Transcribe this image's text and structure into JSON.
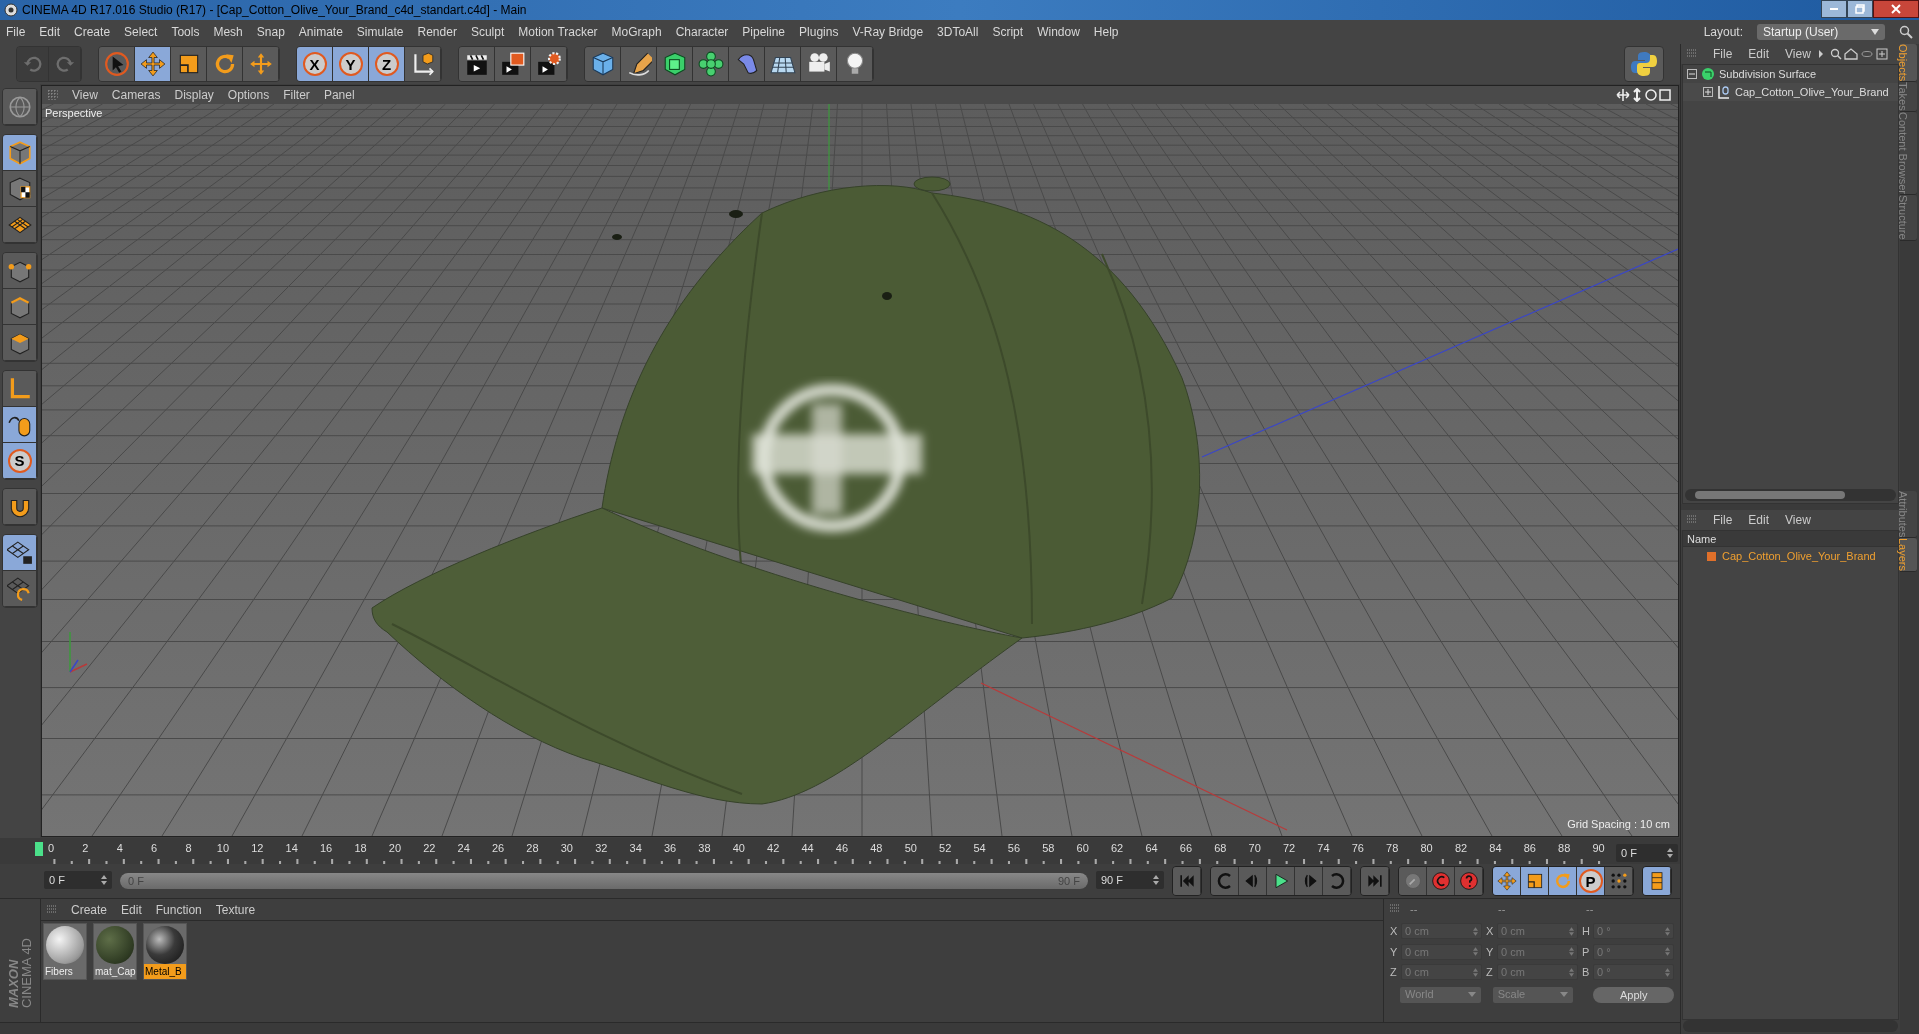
{
  "window": {
    "title": "CINEMA 4D R17.016 Studio (R17) - [Cap_Cotton_Olive_Your_Brand_c4d_standart.c4d] - Main"
  },
  "menu_bar": {
    "items": [
      "File",
      "Edit",
      "Create",
      "Select",
      "Tools",
      "Mesh",
      "Snap",
      "Animate",
      "Simulate",
      "Render",
      "Sculpt",
      "Motion Tracker",
      "MoGraph",
      "Character",
      "Pipeline",
      "Plugins",
      "V-Ray Bridge",
      "3DToAll",
      "Script",
      "Window",
      "Help"
    ],
    "layout_label": "Layout:",
    "layout_value": "Startup (User)"
  },
  "history_buttons": [
    {
      "kind": "undo",
      "disabled": true
    },
    {
      "kind": "redo",
      "disabled": true
    }
  ],
  "toolbar": [
    [
      {
        "kind": "select",
        "selected": false
      },
      {
        "kind": "move",
        "selected": true
      },
      {
        "kind": "scale",
        "selected": false
      },
      {
        "kind": "rotate",
        "selected": false
      },
      {
        "kind": "add",
        "selected": false
      }
    ],
    [
      {
        "kind": "letter",
        "label": "X",
        "selected": true
      },
      {
        "kind": "letter",
        "label": "Y",
        "selected": true
      },
      {
        "kind": "letter",
        "label": "Z",
        "selected": true
      },
      {
        "kind": "coords",
        "selected": false
      }
    ],
    [
      {
        "kind": "render-view",
        "selected": false
      },
      {
        "kind": "render-pv",
        "selected": false
      },
      {
        "kind": "render-settings",
        "selected": false
      }
    ],
    [
      {
        "kind": "cube",
        "selected": false
      },
      {
        "kind": "pen",
        "selected": false
      },
      {
        "kind": "subdiv",
        "selected": false
      },
      {
        "kind": "cloner",
        "selected": false
      },
      {
        "kind": "deformer",
        "selected": false
      },
      {
        "kind": "floor",
        "selected": false
      },
      {
        "kind": "camera",
        "selected": false
      },
      {
        "kind": "light",
        "selected": false
      }
    ]
  ],
  "left_toolbar": [
    [
      {
        "kind": "world",
        "selected": false
      }
    ],
    [
      {
        "kind": "model",
        "selected": true
      },
      {
        "kind": "texture",
        "selected": false
      },
      {
        "kind": "workplane",
        "selected": false
      }
    ],
    [
      {
        "kind": "points",
        "selected": false
      },
      {
        "kind": "edges",
        "selected": false
      },
      {
        "kind": "polygons",
        "selected": false
      }
    ],
    [
      {
        "kind": "axis",
        "selected": false
      },
      {
        "kind": "tweak",
        "selected": true
      },
      {
        "kind": "letter",
        "label": "S",
        "selected": true
      }
    ],
    [
      {
        "kind": "magnet",
        "selected": false
      }
    ],
    [
      {
        "kind": "lock-grid",
        "selected": true
      },
      {
        "kind": "grid-refresh",
        "selected": false
      }
    ]
  ],
  "viewport": {
    "menu": [
      "View",
      "Cameras",
      "Display",
      "Options",
      "Filter",
      "Panel"
    ],
    "camera_label": "Perspective",
    "grid_spacing": "Grid Spacing : 10 cm"
  },
  "timeline": {
    "ticks": [
      "0",
      "2",
      "4",
      "6",
      "8",
      "10",
      "12",
      "14",
      "16",
      "18",
      "20",
      "22",
      "24",
      "26",
      "28",
      "30",
      "32",
      "34",
      "36",
      "38",
      "40",
      "42",
      "44",
      "46",
      "48",
      "50",
      "52",
      "54",
      "56",
      "58",
      "60",
      "62",
      "64",
      "66",
      "68",
      "70",
      "72",
      "74",
      "76",
      "78",
      "80",
      "82",
      "84",
      "86",
      "88",
      "90"
    ],
    "current_frame": "0 F",
    "start_field": "0 F",
    "range": {
      "start": "0 F",
      "end": "90 F",
      "level": 1
    },
    "end_field": "90 F",
    "key_tools": [
      {
        "kind": "record",
        "selected": false
      },
      {
        "kind": "autokey",
        "selected": false
      },
      {
        "kind": "help",
        "selected": false
      },
      {
        "kind": "move",
        "selected": true
      },
      {
        "kind": "scale",
        "selected": true
      },
      {
        "kind": "rotate",
        "selected": true
      },
      {
        "kind": "letter",
        "label": "P",
        "selected": true
      },
      {
        "kind": "dots",
        "selected": false
      },
      {
        "kind": "film",
        "selected": true
      }
    ]
  },
  "materials": {
    "menu": [
      "Create",
      "Edit",
      "Function",
      "Texture"
    ],
    "items": [
      {
        "name": "Fibers",
        "kind": "white",
        "selected": false
      },
      {
        "name": "mat_Cap",
        "kind": "olive",
        "selected": false
      },
      {
        "name": "Metal_B",
        "kind": "metal",
        "selected": true
      }
    ]
  },
  "brand": {
    "line1": "MAXON",
    "line2": "CINEMA 4D"
  },
  "coordinates": {
    "headers": [
      "--",
      "--",
      "--"
    ],
    "rows": [
      {
        "pos_axis": "X",
        "position": "0 cm",
        "size_axis": "X",
        "size": "0 cm",
        "rot_axis": "H",
        "rotation": "0 °"
      },
      {
        "pos_axis": "Y",
        "position": "0 cm",
        "size_axis": "Y",
        "size": "0 cm",
        "rot_axis": "P",
        "rotation": "0 °"
      },
      {
        "pos_axis": "Z",
        "position": "0 cm",
        "size_axis": "Z",
        "size": "0 cm",
        "rot_axis": "B",
        "rotation": "0 °"
      }
    ],
    "dropdowns": [
      "World",
      "Scale"
    ],
    "apply": "Apply"
  },
  "objects_panel": {
    "menu": [
      "File",
      "Edit",
      "View"
    ],
    "tree": [
      {
        "name": "Subdivision Surface",
        "kind": "subdivision",
        "expanded": true,
        "children": [
          {
            "name": "Cap_Cotton_Olive_Your_Brand",
            "kind": "null",
            "expanded": false
          }
        ]
      }
    ]
  },
  "side_tabs_top": [
    {
      "label": "Objects",
      "selected": true
    },
    {
      "label": "Takes",
      "selected": false
    },
    {
      "label": "Content Browser",
      "selected": false
    },
    {
      "label": "Structure",
      "selected": false
    }
  ],
  "layers_panel": {
    "menu": [
      "File",
      "Edit",
      "View"
    ],
    "column": "Name",
    "rows": [
      {
        "name": "Cap_Cotton_Olive_Your_Brand",
        "color": "#e0702a"
      }
    ]
  },
  "side_tabs_bottom": [
    {
      "label": "Attributes",
      "selected": false
    },
    {
      "label": "Layers",
      "selected": true
    }
  ]
}
